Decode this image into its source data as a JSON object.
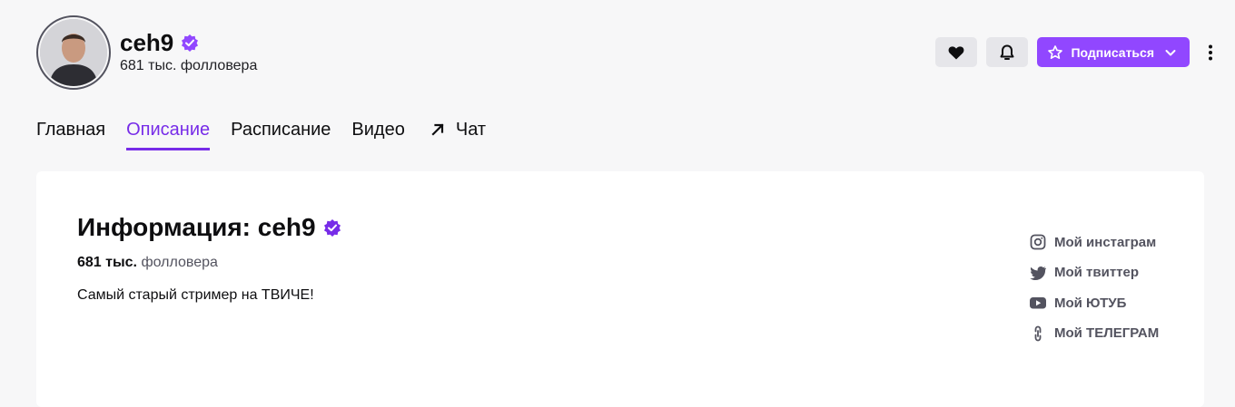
{
  "channel": {
    "name": "ceh9",
    "followers_text": "681 тыс. фолловера"
  },
  "header_actions": {
    "follow_icon": "heart-icon",
    "notify_icon": "bell-icon",
    "subscribe_label": "Подписаться",
    "more_icon": "more-vertical-icon"
  },
  "tabs": [
    {
      "label": "Главная",
      "active": false
    },
    {
      "label": "Описание",
      "active": true
    },
    {
      "label": "Расписание",
      "active": false
    },
    {
      "label": "Видео",
      "active": false
    },
    {
      "label": "Чат",
      "active": false,
      "icon": "arrow-up-right-icon"
    }
  ],
  "about": {
    "title": "Информация: ceh9",
    "followers_count": "681 тыс.",
    "followers_label": "фолловера",
    "description": "Самый старый стример на ТВИЧЕ!"
  },
  "social_links": [
    {
      "label": "Мой инстаграм",
      "icon": "instagram-icon"
    },
    {
      "label": "Мой твиттер",
      "icon": "twitter-icon"
    },
    {
      "label": "Мой ЮТУБ",
      "icon": "youtube-icon"
    },
    {
      "label": "Мой ТЕЛЕГРАМ",
      "icon": "link-icon"
    }
  ],
  "colors": {
    "accent": "#9147ff",
    "accent_text": "#772ce8",
    "background": "#f7f7f8",
    "card": "#ffffff"
  }
}
